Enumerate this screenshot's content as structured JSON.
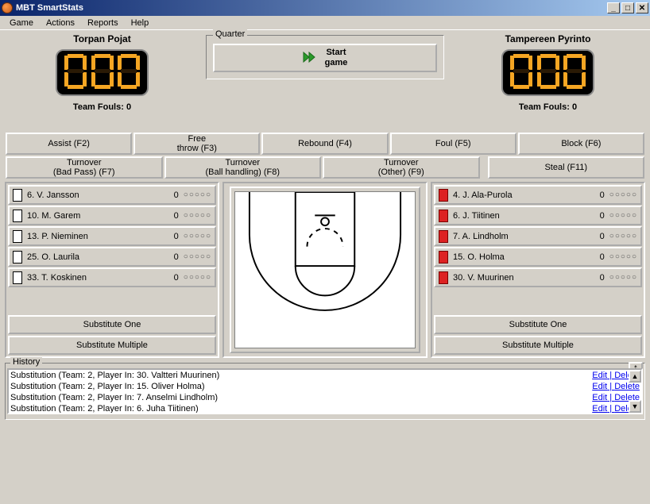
{
  "title": "MBT SmartStats",
  "menu": [
    "Game",
    "Actions",
    "Reports",
    "Help"
  ],
  "quarter_label": "Quarter",
  "start_button": "Start\ngame",
  "stat_buttons_row1": [
    "Assist (F2)",
    "Free\nthrow (F3)",
    "Rebound (F4)",
    "Foul (F5)",
    "Block (F6)"
  ],
  "stat_buttons_row2": [
    "Turnover\n(Bad Pass) (F7)",
    "Turnover\n(Ball handling) (F8)",
    "Turnover\n(Other) (F9)",
    "Steal (F11)"
  ],
  "team1": {
    "name": "Torpan Pojat",
    "score_digits": [
      "0",
      "0",
      "0"
    ],
    "fouls_label": "Team Fouls: 0",
    "players": [
      {
        "label": "6. V. Jansson",
        "pts": "0"
      },
      {
        "label": "10. M. Garem",
        "pts": "0"
      },
      {
        "label": "13. P. Nieminen",
        "pts": "0"
      },
      {
        "label": "25. O. Laurila",
        "pts": "0"
      },
      {
        "label": "33. T. Koskinen",
        "pts": "0"
      }
    ]
  },
  "team2": {
    "name": "Tampereen Pyrinto",
    "score_digits": [
      "0",
      "0",
      "0"
    ],
    "fouls_label": "Team Fouls: 0",
    "players": [
      {
        "label": "4. J. Ala-Purola",
        "pts": "0"
      },
      {
        "label": "6. J. Tiitinen",
        "pts": "0"
      },
      {
        "label": "7. A. Lindholm",
        "pts": "0"
      },
      {
        "label": "15. O. Holma",
        "pts": "0"
      },
      {
        "label": "30. V. Muurinen",
        "pts": "0"
      }
    ]
  },
  "foul_dots": "○○○○○",
  "sub_one": "Substitute One",
  "sub_multi": "Substitute Multiple",
  "history_label": "History",
  "history_edit": "Edit",
  "history_delete": "Delete",
  "history": [
    "Substitution (Team: 2, Player In: 30. Valtteri Muurinen)",
    "Substitution (Team: 2, Player In: 15. Oliver Holma)",
    "Substitution (Team: 2, Player In: 7. Anselmi Lindholm)",
    "Substitution (Team: 2, Player In: 6. Juha Tiitinen)"
  ]
}
